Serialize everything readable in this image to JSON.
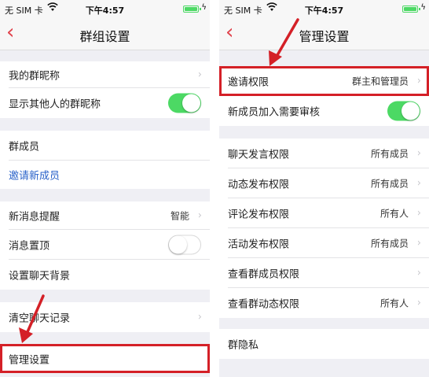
{
  "status_bar": {
    "carrier": "无 SIM 卡",
    "time": "下午4:57"
  },
  "left_screen": {
    "title": "群组设置",
    "rows": {
      "nickname": "我的群昵称",
      "show_nickname": "显示其他人的群昵称",
      "members": "群成员",
      "invite": "邀请新成员",
      "notify": "新消息提醒",
      "notify_value": "智能",
      "pin": "消息置顶",
      "background": "设置聊天背景",
      "clear_history": "清空聊天记录",
      "admin_settings": "管理设置"
    },
    "toggles": {
      "show_nickname": "on",
      "pin": "off"
    }
  },
  "right_screen": {
    "title": "管理设置",
    "rows": {
      "invite_permission": "邀请权限",
      "invite_permission_value": "群主和管理员",
      "join_review": "新成员加入需要审核",
      "chat_permission": "聊天发言权限",
      "chat_permission_value": "所有成员",
      "post_permission": "动态发布权限",
      "post_permission_value": "所有成员",
      "comment_permission": "评论发布权限",
      "comment_permission_value": "所有人",
      "activity_permission": "活动发布权限",
      "activity_permission_value": "所有成员",
      "view_members_permission": "查看群成员权限",
      "view_posts_permission": "查看群动态权限",
      "view_posts_permission_value": "所有人",
      "group_privacy": "群隐私"
    },
    "toggles": {
      "join_review": "on"
    }
  },
  "colors": {
    "accent_red": "#e0414b",
    "highlight_red": "#d42027",
    "toggle_green": "#4cd964",
    "link_blue": "#2a62c9"
  },
  "icons": [
    "back-chevron-icon",
    "chevron-right-icon",
    "wifi-icon",
    "battery-icon",
    "charging-icon"
  ]
}
